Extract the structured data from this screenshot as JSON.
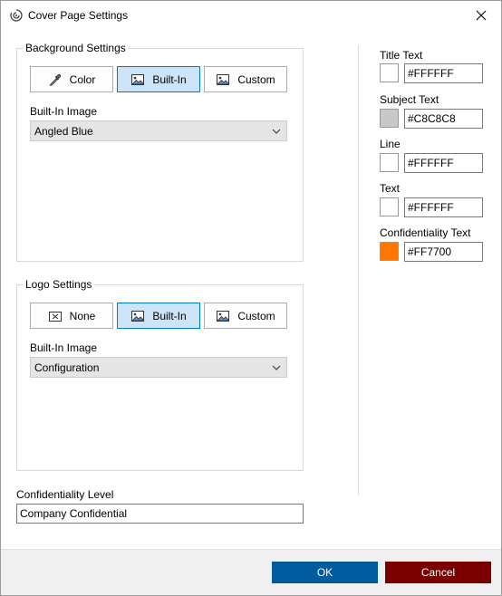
{
  "window": {
    "title": "Cover Page Settings"
  },
  "background": {
    "group_label": "Background Settings",
    "buttons": {
      "color": "Color",
      "builtin": "Built-In",
      "custom": "Custom"
    },
    "image_label": "Built-In Image",
    "image_value": "Angled Blue"
  },
  "logo": {
    "group_label": "Logo Settings",
    "buttons": {
      "none": "None",
      "builtin": "Built-In",
      "custom": "Custom"
    },
    "image_label": "Built-In Image",
    "image_value": "Configuration"
  },
  "confidentiality": {
    "label": "Confidentiality Level",
    "value": "Company Confidential"
  },
  "colors": [
    {
      "label": "Title Text",
      "hex": "#FFFFFF",
      "swatch": "#ffffff"
    },
    {
      "label": "Subject Text",
      "hex": "#C8C8C8",
      "swatch": "#c8c8c8"
    },
    {
      "label": "Line",
      "hex": "#FFFFFF",
      "swatch": "#ffffff"
    },
    {
      "label": "Text",
      "hex": "#FFFFFF",
      "swatch": "#ffffff"
    },
    {
      "label": "Confidentiality Text",
      "hex": "#FF7700",
      "swatch": "#ff7700"
    }
  ],
  "footer": {
    "ok": "OK",
    "cancel": "Cancel",
    "ok_color": "#005a9e",
    "cancel_color": "#7a0000"
  }
}
